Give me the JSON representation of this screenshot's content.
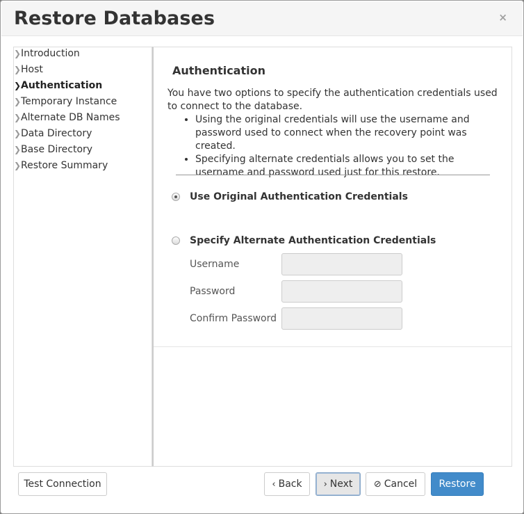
{
  "dialog": {
    "title": "Restore Databases",
    "close_glyph": "×"
  },
  "sidebar": {
    "items": [
      {
        "label": "Introduction",
        "active": false
      },
      {
        "label": "Host",
        "active": false
      },
      {
        "label": "Authentication",
        "active": true
      },
      {
        "label": "Temporary Instance",
        "active": false
      },
      {
        "label": "Alternate DB Names",
        "active": false
      },
      {
        "label": "Data Directory",
        "active": false
      },
      {
        "label": "Base Directory",
        "active": false
      },
      {
        "label": "Restore Summary",
        "active": false
      }
    ]
  },
  "main": {
    "section_title": "Authentication",
    "intro": "You have two options to specify the authentication credentials used to connect to the database.",
    "bullets": [
      "Using the original credentials will use the username and password used to connect when the recovery point was created.",
      "Specifying alternate credentials allows you to set the username and password used just for this restore."
    ],
    "options": {
      "original": {
        "label": "Use Original Authentication Credentials",
        "selected": true
      },
      "alternate": {
        "label": "Specify Alternate Authentication Credentials",
        "selected": false
      }
    },
    "fields": {
      "username": {
        "label": "Username",
        "value": ""
      },
      "password": {
        "label": "Password",
        "value": ""
      },
      "confirm_password": {
        "label": "Confirm Password",
        "value": ""
      }
    }
  },
  "footer": {
    "test_connection": "Test Connection",
    "back": "Back",
    "next": "Next",
    "cancel": "Cancel",
    "restore": "Restore"
  },
  "colors": {
    "primary": "#428bca",
    "header_bg": "#f5f5f5"
  }
}
